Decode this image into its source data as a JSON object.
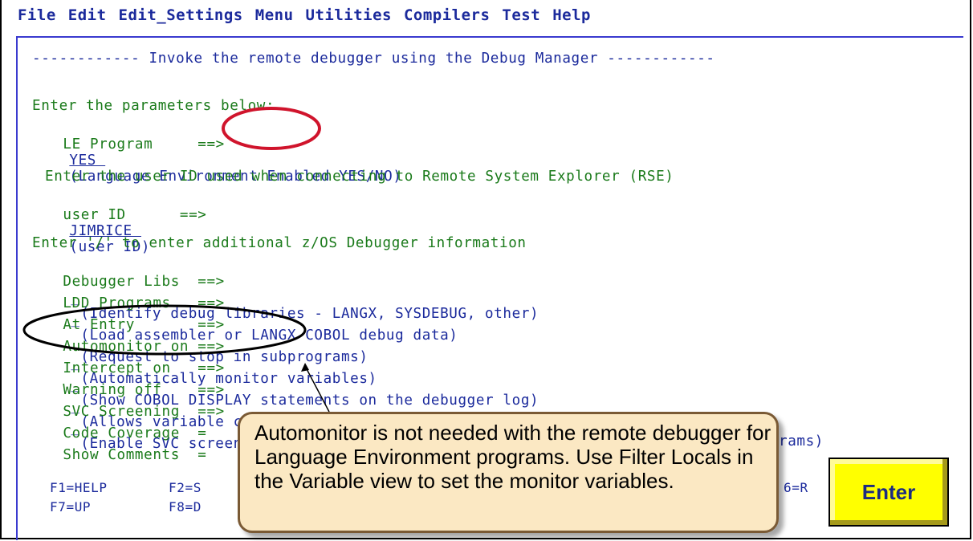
{
  "menubar": {
    "items": [
      "File",
      "Edit",
      "Edit_Settings",
      "Menu",
      "Utilities",
      "Compilers",
      "Test",
      "Help"
    ]
  },
  "panel": {
    "title_line": "------------ Invoke the remote debugger using the Debug Manager ------------",
    "params_heading": "Enter the parameters below:",
    "le_program": {
      "label": "LE Program     ==>",
      "value": "YES ",
      "hint": "(Language Environment Enabled YES/NO)"
    },
    "userid_heading": "Enter the user ID used when connecting to Remote System Explorer (RSE)",
    "user_id": {
      "label": "user ID      ==>",
      "value": "JIMRICE ",
      "hint": "(user ID)"
    },
    "options_heading": "Enter '/' to enter additional z/OS Debugger information",
    "options": [
      {
        "label": "Debugger Libs  ==>",
        "value": "_",
        "hint": "(Identify debug libraries - LANGX, SYSDEBUG, other)"
      },
      {
        "label": "LDD Programs   ==>",
        "value": "_",
        "hint": "(Load assembler or LANGX COBOL debug data)"
      },
      {
        "label": "At Entry       ==>",
        "value": "_",
        "hint": "(Request to stop in subprograms)"
      },
      {
        "label": "Automonitor on ==>",
        "value": "_",
        "hint": "(Automatically monitor variables)"
      },
      {
        "label": "Intercept on   ==>",
        "value": "_",
        "hint": "(Show COBOL DISPLAY statements on the debugger log)"
      },
      {
        "label": "Warning off    ==>",
        "value": "_",
        "hint": "(Allows variable changes for optimized programs)"
      },
      {
        "label": "SVC Screening  ==>",
        "value": "_",
        "hint": "(Enable SVC screening for batch non-LE programs)"
      },
      {
        "label": "Code Coverage  =",
        "value": "",
        "hint": ""
      },
      {
        "label": "Show Comments  =",
        "value": "",
        "hint": "rams)"
      }
    ],
    "fkeys_row1": {
      "f1": "F1=HELP",
      "f2": "F2=S",
      "f6": "6=R"
    },
    "fkeys_row2": {
      "f7": "F7=UP",
      "f8": "F8=D"
    }
  },
  "callout": {
    "text": "Automonitor is not needed with the remote debugger for Language Environment programs. Use Filter Locals in the Variable view to set the monitor variables."
  },
  "enter_button": {
    "label": "Enter"
  },
  "colors": {
    "field_blue": "#1b2a9c",
    "text_green": "#1a7a1a",
    "highlight_red": "#d0142c",
    "button_yellow": "#ffff00",
    "callout_bg": "#fbe8c3"
  }
}
